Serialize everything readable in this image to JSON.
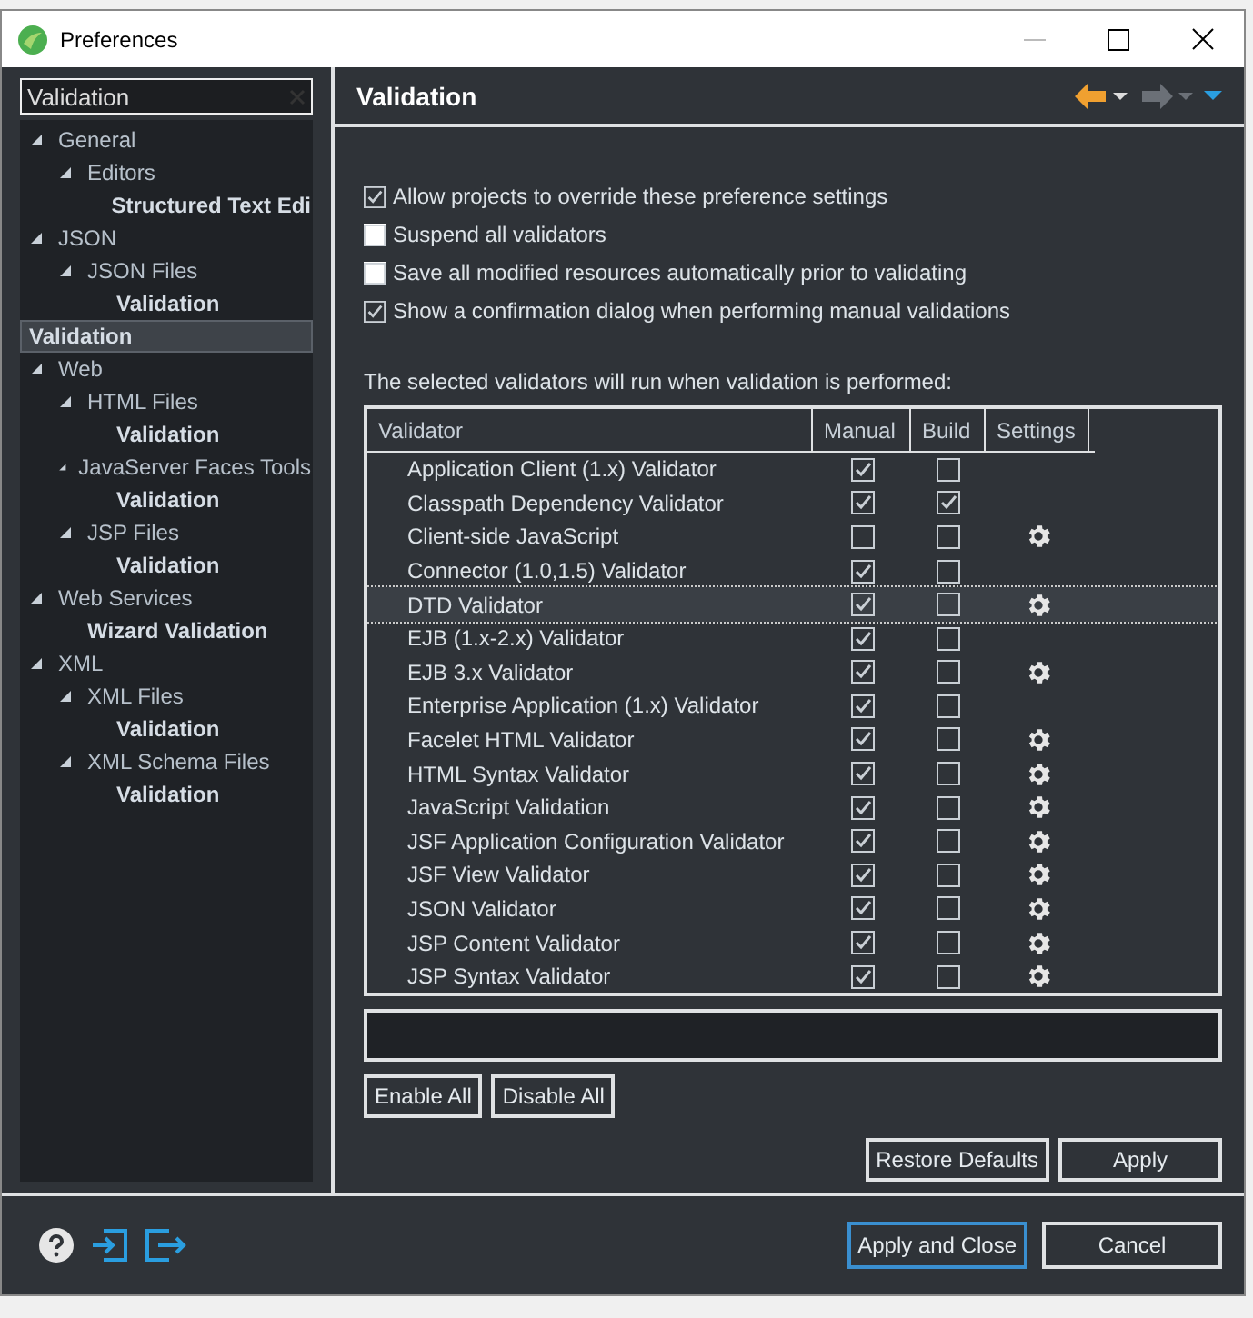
{
  "window": {
    "title": "Preferences"
  },
  "filter": {
    "value": "Validation"
  },
  "tree": [
    {
      "label": "General",
      "expanded": true,
      "match": false,
      "selected": false,
      "children": [
        {
          "label": "Editors",
          "expanded": true,
          "match": false,
          "selected": false,
          "children": [
            {
              "label": "Structured Text Edi",
              "match": true,
              "selected": false
            }
          ]
        }
      ]
    },
    {
      "label": "JSON",
      "expanded": true,
      "match": false,
      "selected": false,
      "children": [
        {
          "label": "JSON Files",
          "expanded": true,
          "match": false,
          "selected": false,
          "children": [
            {
              "label": "Validation",
              "match": true,
              "selected": false
            }
          ]
        }
      ]
    },
    {
      "label": "Validation",
      "match": true,
      "selected": true
    },
    {
      "label": "Web",
      "expanded": true,
      "match": false,
      "selected": false,
      "children": [
        {
          "label": "HTML Files",
          "expanded": true,
          "match": false,
          "selected": false,
          "children": [
            {
              "label": "Validation",
              "match": true,
              "selected": false
            }
          ]
        },
        {
          "label": "JavaServer Faces Tools",
          "expanded": true,
          "match": false,
          "selected": false,
          "children": [
            {
              "label": "Validation",
              "match": true,
              "selected": false
            }
          ]
        },
        {
          "label": "JSP Files",
          "expanded": true,
          "match": false,
          "selected": false,
          "children": [
            {
              "label": "Validation",
              "match": true,
              "selected": false
            }
          ]
        }
      ]
    },
    {
      "label": "Web Services",
      "expanded": true,
      "match": false,
      "selected": false,
      "children": [
        {
          "label": "Wizard Validation",
          "match": true,
          "selected": false
        }
      ]
    },
    {
      "label": "XML",
      "expanded": true,
      "match": false,
      "selected": false,
      "children": [
        {
          "label": "XML Files",
          "expanded": true,
          "match": false,
          "selected": false,
          "children": [
            {
              "label": "Validation",
              "match": true,
              "selected": false
            }
          ]
        },
        {
          "label": "XML Schema Files",
          "expanded": true,
          "match": false,
          "selected": false,
          "children": [
            {
              "label": "Validation",
              "match": true,
              "selected": false
            }
          ]
        }
      ]
    }
  ],
  "page": {
    "title": "Validation"
  },
  "options": [
    {
      "label": "Allow projects to override these preference settings",
      "checked": true
    },
    {
      "label": "Suspend all validators",
      "checked": false
    },
    {
      "label": "Save all modified resources automatically prior to validating",
      "checked": false
    },
    {
      "label": "Show a confirmation dialog when performing manual validations",
      "checked": true
    }
  ],
  "table_caption": "The selected validators will run when validation is performed:",
  "columns": [
    "Validator",
    "Manual",
    "Build",
    "Settings"
  ],
  "rows": [
    {
      "name": "Application Client (1.x) Validator",
      "manual": true,
      "build": false,
      "settings": false,
      "selected": false
    },
    {
      "name": "Classpath Dependency Validator",
      "manual": true,
      "build": true,
      "settings": false,
      "selected": false
    },
    {
      "name": "Client-side JavaScript",
      "manual": false,
      "build": false,
      "settings": true,
      "selected": false
    },
    {
      "name": "Connector (1.0,1.5) Validator",
      "manual": true,
      "build": false,
      "settings": false,
      "selected": false
    },
    {
      "name": "DTD Validator",
      "manual": true,
      "build": false,
      "settings": true,
      "selected": true
    },
    {
      "name": "EJB (1.x-2.x) Validator",
      "manual": true,
      "build": false,
      "settings": false,
      "selected": false
    },
    {
      "name": "EJB 3.x Validator",
      "manual": true,
      "build": false,
      "settings": true,
      "selected": false
    },
    {
      "name": "Enterprise Application (1.x) Validator",
      "manual": true,
      "build": false,
      "settings": false,
      "selected": false
    },
    {
      "name": "Facelet HTML Validator",
      "manual": true,
      "build": false,
      "settings": true,
      "selected": false
    },
    {
      "name": "HTML Syntax Validator",
      "manual": true,
      "build": false,
      "settings": true,
      "selected": false
    },
    {
      "name": "JavaScript Validation",
      "manual": true,
      "build": false,
      "settings": true,
      "selected": false
    },
    {
      "name": "JSF Application Configuration Validator",
      "manual": true,
      "build": false,
      "settings": true,
      "selected": false
    },
    {
      "name": "JSF View Validator",
      "manual": true,
      "build": false,
      "settings": true,
      "selected": false
    },
    {
      "name": "JSON Validator",
      "manual": true,
      "build": false,
      "settings": true,
      "selected": false
    },
    {
      "name": "JSP Content Validator",
      "manual": true,
      "build": false,
      "settings": true,
      "selected": false
    },
    {
      "name": "JSP Syntax Validator",
      "manual": true,
      "build": false,
      "settings": true,
      "selected": false
    }
  ],
  "table_buttons": [
    "Enable All",
    "Disable All"
  ],
  "page_buttons": [
    "Restore Defaults",
    "Apply"
  ],
  "dialog_buttons": [
    {
      "label": "Apply and Close",
      "default": true
    },
    {
      "label": "Cancel",
      "default": false
    }
  ]
}
